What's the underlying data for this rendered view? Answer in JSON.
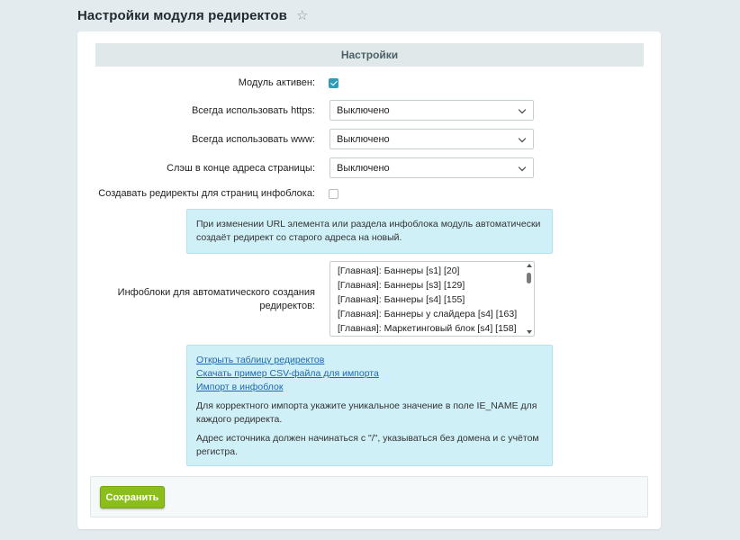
{
  "page": {
    "title": "Настройки модуля редиректов",
    "star_icon": "star-icon"
  },
  "section": {
    "title": "Настройки"
  },
  "fields": {
    "module_active": {
      "label": "Модуль активен:",
      "checked": true
    },
    "https": {
      "label": "Всегда использовать https:",
      "value": "Выключено"
    },
    "www": {
      "label": "Всегда использовать www:",
      "value": "Выключено"
    },
    "slash": {
      "label": "Слэш в конце адреса страницы:",
      "value": "Выключено"
    },
    "iblock_redirects": {
      "label": "Создавать редиректы для страниц инфоблока:",
      "checked": false
    }
  },
  "info1": {
    "text": "При изменении URL элемента или раздела инфоблока модуль автоматически создаёт редирект со старого адреса на новый."
  },
  "iblocks": {
    "label": "Инфоблоки для автоматического создания редиректов:",
    "items": [
      "[Главная]: Баннеры [s1] [20]",
      "[Главная]: Баннеры [s3] [129]",
      "[Главная]: Баннеры [s4] [155]",
      "[Главная]: Баннеры у слайдера [s4] [163]",
      "[Главная]: Маркетинговый блок [s4] [158]"
    ]
  },
  "info2": {
    "links": {
      "open_table": "Открыть таблицу редиректов",
      "download_csv": "Скачать пример CSV-файла для импорта",
      "import": "Импорт в инфоблок"
    },
    "p1": "Для корректного импорта укажите уникальное значение в поле IE_NAME для каждого редиректа.",
    "p2": "Адрес источника должен начинаться с \"/\", указываться без домена и с учётом регистра."
  },
  "footer": {
    "save_label": "Сохранить"
  },
  "colors": {
    "accent": "#2f9dba",
    "save": "#8bbd1b",
    "info_bg": "#d0f0f7"
  }
}
